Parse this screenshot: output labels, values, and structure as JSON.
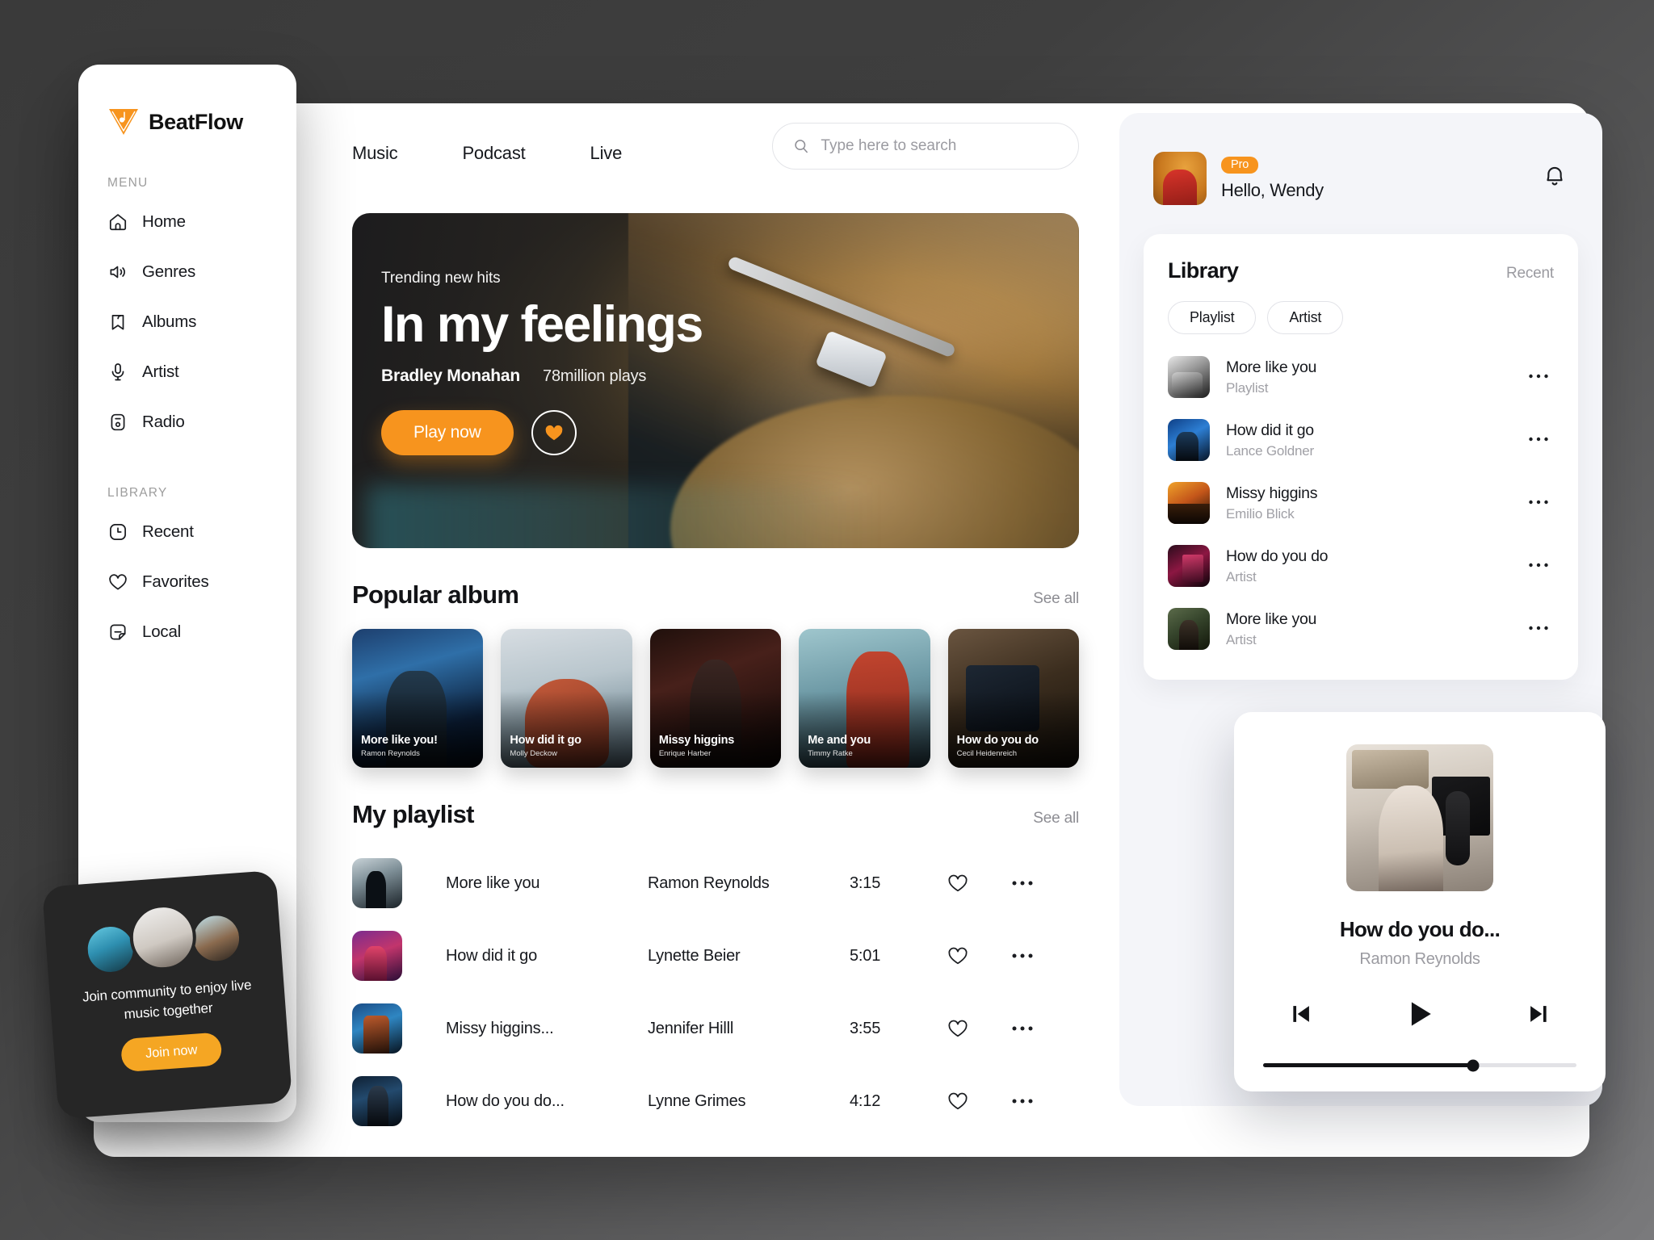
{
  "brand": {
    "name": "BeatFlow"
  },
  "sidebar": {
    "menu_label": "MENU",
    "menu_items": [
      {
        "label": "Home",
        "icon": "home-icon"
      },
      {
        "label": "Genres",
        "icon": "speaker-icon"
      },
      {
        "label": "Albums",
        "icon": "bookmark-icon"
      },
      {
        "label": "Artist",
        "icon": "microphone-icon"
      },
      {
        "label": "Radio",
        "icon": "radio-icon"
      }
    ],
    "library_label": "LIBRARY",
    "library_items": [
      {
        "label": "Recent",
        "icon": "clock-icon"
      },
      {
        "label": "Favorites",
        "icon": "heart-icon"
      },
      {
        "label": "Local",
        "icon": "note-file-icon"
      }
    ]
  },
  "community": {
    "text": "Join community to enjoy live music together",
    "button_label": "Join now"
  },
  "topnav": {
    "items": [
      "Music",
      "Podcast",
      "Live"
    ]
  },
  "search": {
    "placeholder": "Type here to search",
    "value": ""
  },
  "hero": {
    "eyebrow": "Trending new hits",
    "title": "In my feelings",
    "artist": "Bradley Monahan",
    "plays": "78million plays",
    "play_label": "Play now",
    "like_icon": "heart-icon"
  },
  "popular_album": {
    "title": "Popular album",
    "see_all": "See all",
    "cards": [
      {
        "title": "More like you!",
        "artist": "Ramon Reynolds"
      },
      {
        "title": "How did it go",
        "artist": "Molly Deckow"
      },
      {
        "title": "Missy higgins",
        "artist": "Enrique Harber"
      },
      {
        "title": "Me and you",
        "artist": "Timmy Ratke"
      },
      {
        "title": "How do you do",
        "artist": "Cecil Heidenreich"
      }
    ]
  },
  "my_playlist": {
    "title": "My playlist",
    "see_all": "See all",
    "tracks": [
      {
        "name": "More like you",
        "artist": "Ramon Reynolds",
        "time": "3:15"
      },
      {
        "name": "How did it go",
        "artist": "Lynette Beier",
        "time": "5:01"
      },
      {
        "name": "Missy higgins...",
        "artist": "Jennifer Hilll",
        "time": "3:55"
      },
      {
        "name": "How do you do...",
        "artist": "Lynne Grimes",
        "time": "4:12"
      }
    ]
  },
  "user": {
    "badge": "Pro",
    "greeting": "Hello, Wendy"
  },
  "library": {
    "title": "Library",
    "recent_label": "Recent",
    "tabs": [
      "Playlist",
      "Artist"
    ],
    "items": [
      {
        "name": "More like you",
        "sub": "Playlist"
      },
      {
        "name": "How did it go",
        "sub": "Lance Goldner"
      },
      {
        "name": "Missy higgins",
        "sub": "Emilio Blick"
      },
      {
        "name": "How do you do",
        "sub": "Artist"
      },
      {
        "name": "More like you",
        "sub": "Artist"
      }
    ]
  },
  "player": {
    "title": "How do you do...",
    "artist": "Ramon Reynolds",
    "progress_percent": 67
  },
  "colors": {
    "accent": "#F7941E",
    "accent_soft": "#F5A623",
    "text": "#16181d",
    "muted": "#9b9ba1",
    "panel": "#f4f5f9"
  }
}
